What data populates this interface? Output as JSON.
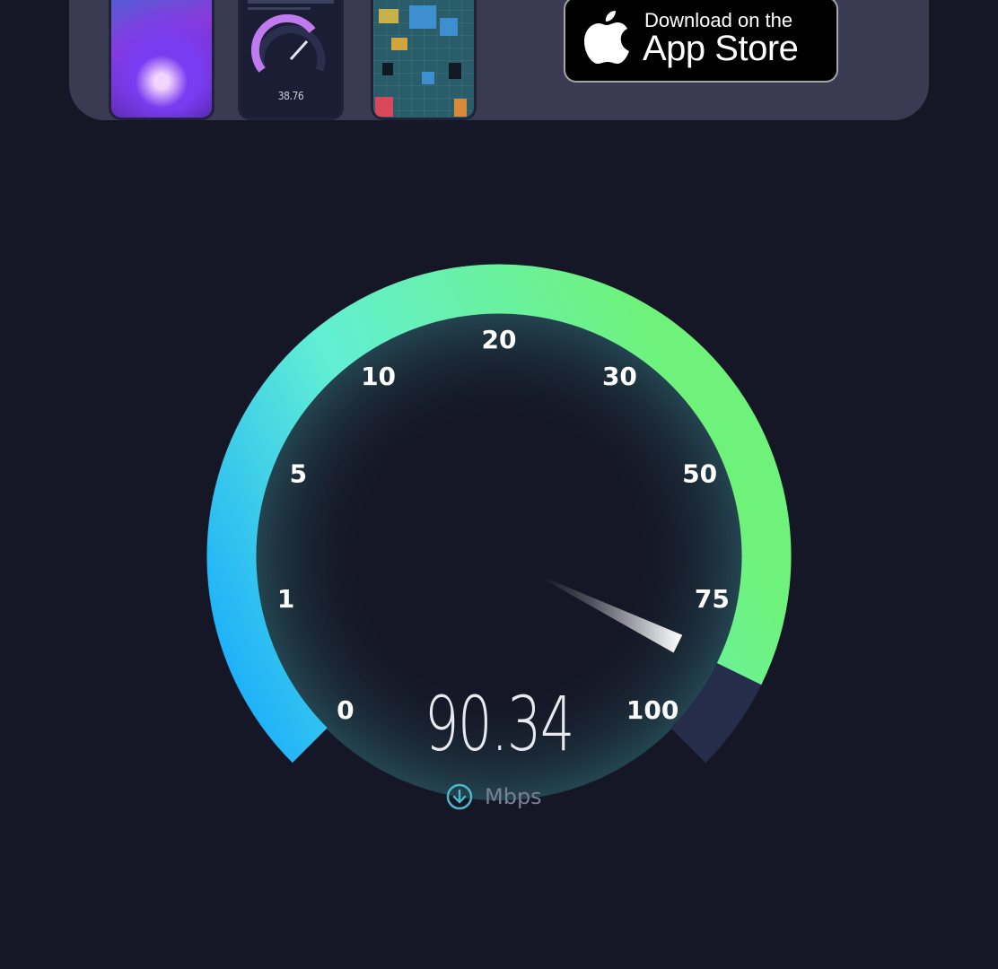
{
  "promo": {
    "phone_gauge_value": "38.76",
    "app_store": {
      "line1": "Download on the",
      "line2": "App Store",
      "icon": "apple-icon"
    }
  },
  "gauge": {
    "ticks": [
      "0",
      "1",
      "5",
      "10",
      "20",
      "30",
      "50",
      "75",
      "100"
    ],
    "value": "90.34",
    "unit": "Mbps",
    "unit_icon": "download-arrow-icon",
    "needle_position": 0.93,
    "colors": {
      "arc_start": "#16a9ff",
      "arc_mid": "#62efd4",
      "arc_end": "#6ff27a",
      "track_remaining": "#262d4a",
      "background": "#151726"
    }
  }
}
